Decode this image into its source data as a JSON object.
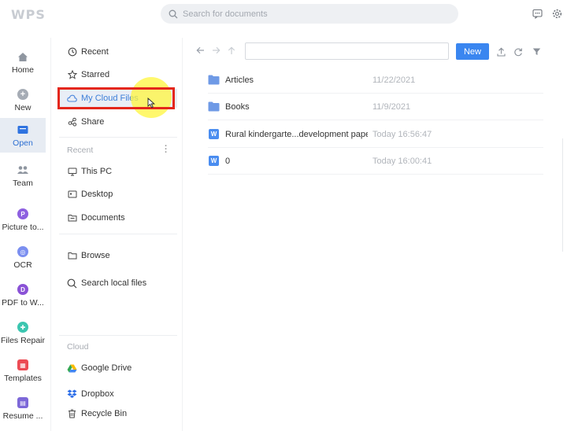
{
  "app": {
    "logo": "WPS"
  },
  "search": {
    "placeholder": "Search for documents"
  },
  "rail": {
    "items": [
      {
        "label": "Home",
        "icon": "home-icon"
      },
      {
        "label": "New",
        "icon": "plus-circle-icon"
      },
      {
        "label": "Open",
        "icon": "folder-icon",
        "active": true
      },
      {
        "label": "Team",
        "icon": "team-icon"
      },
      {
        "label": "Picture to...",
        "icon": "picture-to-pdf-icon"
      },
      {
        "label": "OCR",
        "icon": "ocr-icon"
      },
      {
        "label": "PDF to W...",
        "icon": "pdf-to-word-icon"
      },
      {
        "label": "Files Repair",
        "icon": "files-repair-icon"
      },
      {
        "label": "Templates",
        "icon": "templates-icon"
      },
      {
        "label": "Resume ...",
        "icon": "resume-icon"
      }
    ]
  },
  "nav": {
    "top": [
      {
        "label": "Recent",
        "icon": "clock-icon"
      },
      {
        "label": "Starred",
        "icon": "star-icon"
      },
      {
        "label": "My Cloud Files",
        "icon": "cloud-icon",
        "selected": true
      },
      {
        "label": "Share",
        "icon": "share-icon"
      }
    ],
    "recent_section": "Recent",
    "local": [
      {
        "label": "This PC",
        "icon": "computer-icon"
      },
      {
        "label": "Desktop",
        "icon": "desktop-icon"
      },
      {
        "label": "Documents",
        "icon": "documents-folder-icon"
      }
    ],
    "browse": "Browse",
    "search_local": "Search local files",
    "cloud_section": "Cloud",
    "cloud": [
      {
        "label": "Google Drive",
        "icon": "google-drive-icon"
      },
      {
        "label": "Dropbox",
        "icon": "dropbox-icon"
      },
      {
        "label": "Recycle Bin",
        "icon": "recycle-bin-icon"
      }
    ]
  },
  "toolbar": {
    "new_label": "New",
    "path_value": ""
  },
  "files": [
    {
      "name": "Articles",
      "date": "11/22/2021",
      "type": "folder"
    },
    {
      "name": "Books",
      "date": "11/9/2021",
      "type": "folder"
    },
    {
      "name": "Rural kindergarte...development paper",
      "date": "Today 16:56:47",
      "type": "word"
    },
    {
      "name": "0",
      "date": "Today 16:00:41",
      "type": "word"
    }
  ],
  "colors": {
    "accent": "#3a86f0",
    "highlight": "#e4261a",
    "folder": "#6f9ae6"
  }
}
